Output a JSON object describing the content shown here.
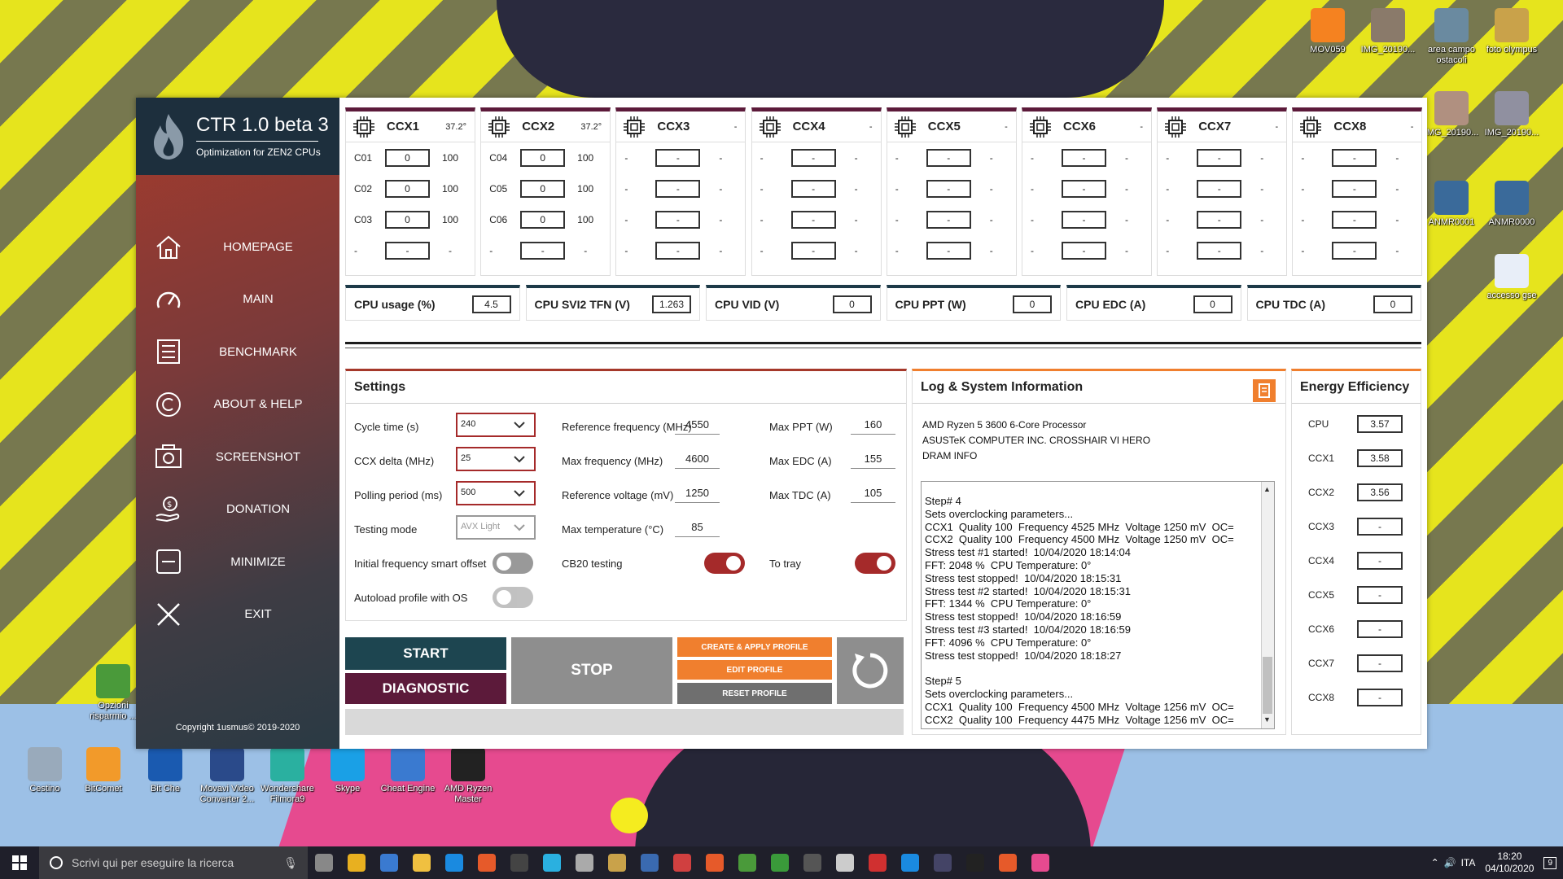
{
  "app": {
    "title": "CTR 1.0 beta 3",
    "subtitle": "Optimization for ZEN2 CPUs",
    "copyright": "Copyright 1usmus© 2019-2020"
  },
  "nav": [
    {
      "label": "HOMEPAGE",
      "icon": "home-icon"
    },
    {
      "label": "MAIN",
      "icon": "speedometer-icon"
    },
    {
      "label": "BENCHMARK",
      "icon": "list-icon"
    },
    {
      "label": "ABOUT & HELP",
      "icon": "copyright-icon"
    },
    {
      "label": "SCREENSHOT",
      "icon": "camera-icon"
    },
    {
      "label": "DONATION",
      "icon": "donation-icon"
    },
    {
      "label": "MINIMIZE",
      "icon": "minimize-icon"
    },
    {
      "label": "EXIT",
      "icon": "close-icon"
    }
  ],
  "ccx": [
    {
      "name": "CCX1",
      "temp": "37.2°",
      "cores": [
        {
          "label": "C01",
          "value": "0",
          "q": "100"
        },
        {
          "label": "C02",
          "value": "0",
          "q": "100"
        },
        {
          "label": "C03",
          "value": "0",
          "q": "100"
        },
        {
          "label": "-",
          "value": "-",
          "q": "-"
        }
      ]
    },
    {
      "name": "CCX2",
      "temp": "37.2°",
      "cores": [
        {
          "label": "C04",
          "value": "0",
          "q": "100"
        },
        {
          "label": "C05",
          "value": "0",
          "q": "100"
        },
        {
          "label": "C06",
          "value": "0",
          "q": "100"
        },
        {
          "label": "-",
          "value": "-",
          "q": "-"
        }
      ]
    },
    {
      "name": "CCX3",
      "temp": "-",
      "cores": [
        {
          "label": "-",
          "value": "-",
          "q": "-"
        },
        {
          "label": "-",
          "value": "-",
          "q": "-"
        },
        {
          "label": "-",
          "value": "-",
          "q": "-"
        },
        {
          "label": "-",
          "value": "-",
          "q": "-"
        }
      ]
    },
    {
      "name": "CCX4",
      "temp": "-",
      "cores": [
        {
          "label": "-",
          "value": "-",
          "q": "-"
        },
        {
          "label": "-",
          "value": "-",
          "q": "-"
        },
        {
          "label": "-",
          "value": "-",
          "q": "-"
        },
        {
          "label": "-",
          "value": "-",
          "q": "-"
        }
      ]
    },
    {
      "name": "CCX5",
      "temp": "-",
      "cores": [
        {
          "label": "-",
          "value": "-",
          "q": "-"
        },
        {
          "label": "-",
          "value": "-",
          "q": "-"
        },
        {
          "label": "-",
          "value": "-",
          "q": "-"
        },
        {
          "label": "-",
          "value": "-",
          "q": "-"
        }
      ]
    },
    {
      "name": "CCX6",
      "temp": "-",
      "cores": [
        {
          "label": "-",
          "value": "-",
          "q": "-"
        },
        {
          "label": "-",
          "value": "-",
          "q": "-"
        },
        {
          "label": "-",
          "value": "-",
          "q": "-"
        },
        {
          "label": "-",
          "value": "-",
          "q": "-"
        }
      ]
    },
    {
      "name": "CCX7",
      "temp": "-",
      "cores": [
        {
          "label": "-",
          "value": "-",
          "q": "-"
        },
        {
          "label": "-",
          "value": "-",
          "q": "-"
        },
        {
          "label": "-",
          "value": "-",
          "q": "-"
        },
        {
          "label": "-",
          "value": "-",
          "q": "-"
        }
      ]
    },
    {
      "name": "CCX8",
      "temp": "-",
      "cores": [
        {
          "label": "-",
          "value": "-",
          "q": "-"
        },
        {
          "label": "-",
          "value": "-",
          "q": "-"
        },
        {
          "label": "-",
          "value": "-",
          "q": "-"
        },
        {
          "label": "-",
          "value": "-",
          "q": "-"
        }
      ]
    }
  ],
  "metrics": [
    {
      "label": "CPU usage (%)",
      "value": "4.5"
    },
    {
      "label": "CPU SVI2 TFN (V)",
      "value": "1.263"
    },
    {
      "label": "CPU VID (V)",
      "value": "0"
    },
    {
      "label": "CPU PPT (W)",
      "value": "0"
    },
    {
      "label": "CPU EDC (A)",
      "value": "0"
    },
    {
      "label": "CPU TDC (A)",
      "value": "0"
    }
  ],
  "settings": {
    "title": "Settings",
    "cycle_time_label": "Cycle time (s)",
    "cycle_time": "240",
    "ccx_delta_label": "CCX delta (MHz)",
    "ccx_delta": "25",
    "polling_label": "Polling period (ms)",
    "polling": "500",
    "testing_mode_label": "Testing mode",
    "testing_mode": "AVX Light",
    "smart_offset_label": "Initial frequency smart offset",
    "autoload_label": "Autoload profile with OS",
    "ref_freq_label": "Reference frequency (MHz)",
    "ref_freq": "4550",
    "max_freq_label": "Max frequency (MHz)",
    "max_freq": "4600",
    "ref_volt_label": "Reference voltage (mV)",
    "ref_volt": "1250",
    "max_temp_label": "Max temperature (°C)",
    "max_temp": "85",
    "cb20_label": "CB20 testing",
    "max_ppt_label": "Max PPT (W)",
    "max_ppt": "160",
    "max_edc_label": "Max EDC (A)",
    "max_edc": "155",
    "max_tdc_label": "Max TDC (A)",
    "max_tdc": "105",
    "to_tray_label": "To tray"
  },
  "buttons": {
    "start": "START",
    "diagnostic": "DIAGNOSTIC",
    "stop": "STOP",
    "create_profile": "CREATE & APPLY PROFILE",
    "edit_profile": "EDIT PROFILE",
    "reset_profile": "RESET PROFILE"
  },
  "log": {
    "title": "Log & System Information",
    "cpu": "AMD Ryzen 5 3600 6-Core Processor",
    "board": "ASUSTeK COMPUTER INC. CROSSHAIR VI HERO",
    "dram": "DRAM INFO",
    "lines": [
      "Step# 4",
      "Sets overclocking parameters...",
      "CCX1  Quality 100  Frequency 4525 MHz  Voltage 1250 mV  OC=",
      "CCX2  Quality 100  Frequency 4500 MHz  Voltage 1250 mV  OC=",
      "Stress test #1 started!  10/04/2020 18:14:04",
      "FFT: 2048 %  CPU Temperature: 0°",
      "Stress test stopped!  10/04/2020 18:15:31",
      "Stress test #2 started!  10/04/2020 18:15:31",
      "FFT: 1344 %  CPU Temperature: 0°",
      "Stress test stopped!  10/04/2020 18:16:59",
      "Stress test #3 started!  10/04/2020 18:16:59",
      "FFT: 4096 %  CPU Temperature: 0°",
      "Stress test stopped!  10/04/2020 18:18:27",
      "",
      "Step# 5",
      "Sets overclocking parameters...",
      "CCX1  Quality 100  Frequency 4500 MHz  Voltage 1256 mV  OC=",
      "CCX2  Quality 100  Frequency 4475 MHz  Voltage 1256 mV  OC="
    ]
  },
  "energy": {
    "title": "Energy Efficiency",
    "rows": [
      {
        "label": "CPU",
        "value": "3.57"
      },
      {
        "label": "CCX1",
        "value": "3.58"
      },
      {
        "label": "CCX2",
        "value": "3.56"
      },
      {
        "label": "CCX3",
        "value": "-"
      },
      {
        "label": "CCX4",
        "value": "-"
      },
      {
        "label": "CCX5",
        "value": "-"
      },
      {
        "label": "CCX6",
        "value": "-"
      },
      {
        "label": "CCX7",
        "value": "-"
      },
      {
        "label": "CCX8",
        "value": "-"
      }
    ]
  },
  "desktop_icons": [
    {
      "label": "MOV059",
      "color": "#f58220"
    },
    {
      "label": "IMG_20190...",
      "color": "#8a7a6a"
    },
    {
      "label": "area campo ostacoli",
      "color": "#6a8aa0"
    },
    {
      "label": "foto olympus",
      "color": "#c9a24a"
    },
    {
      "label": "IMG_20190...",
      "color": "#b09080"
    },
    {
      "label": "IMG_20190...",
      "color": "#9090a0"
    },
    {
      "label": "ANMR0001",
      "color": "#3a6a9a"
    },
    {
      "label": "ANMR0000",
      "color": "#3a6a9a"
    },
    {
      "label": "accesso gse",
      "color": "#e8eef8"
    },
    {
      "label": "Opzioni risparmio ...",
      "color": "#4a9a3a"
    },
    {
      "label": "Cestino",
      "color": "#9ab"
    },
    {
      "label": "BitComet",
      "color": "#f29a2a"
    },
    {
      "label": "Bit Che",
      "color": "#1a5ab0"
    },
    {
      "label": "Movavi Video Converter 2...",
      "color": "#2a4a8a"
    },
    {
      "label": "Wondershare Filmora9",
      "color": "#2ab0a0"
    },
    {
      "label": "Skype",
      "color": "#1aa0e6"
    },
    {
      "label": "Cheat Engine",
      "color": "#3a7ad0"
    },
    {
      "label": "AMD Ryzen Master",
      "color": "#222"
    }
  ],
  "taskbar": {
    "search_placeholder": "Scrivi qui per eseguire la ricerca",
    "language": "ITA",
    "time": "18:20",
    "date": "04/10/2020",
    "notifications": "9"
  }
}
